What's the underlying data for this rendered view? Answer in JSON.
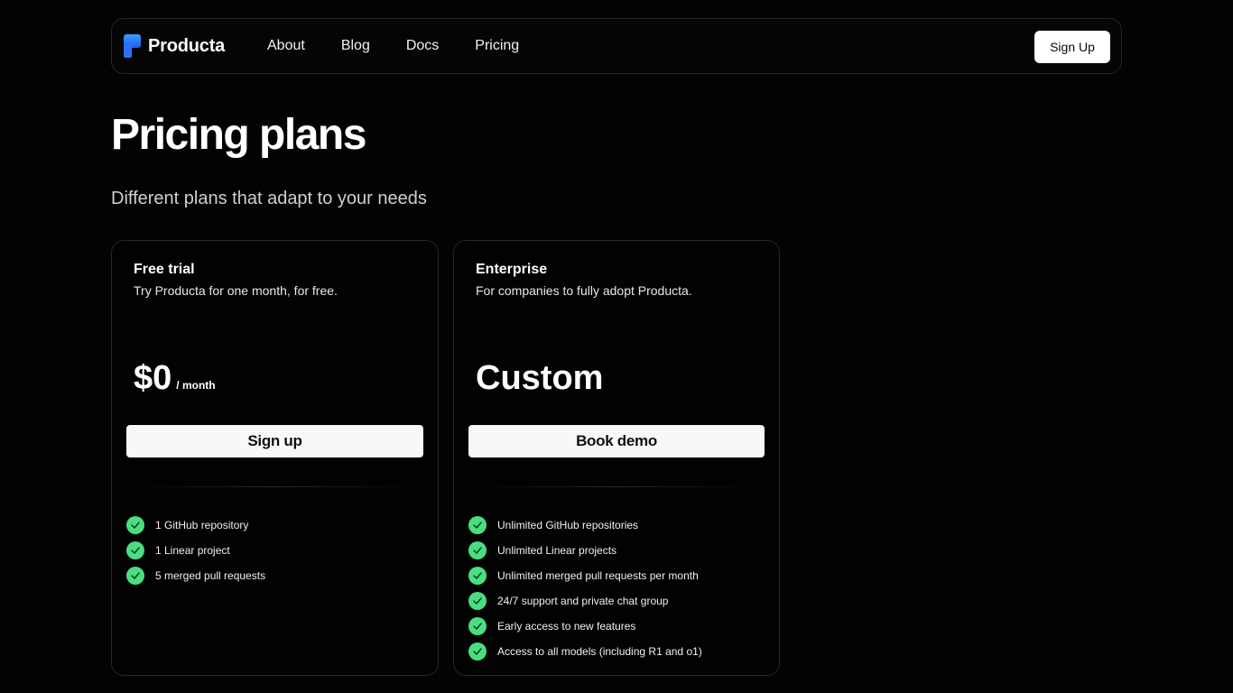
{
  "nav": {
    "brand": "Producta",
    "links": [
      "About",
      "Blog",
      "Docs",
      "Pricing"
    ],
    "signup_label": "Sign Up"
  },
  "page": {
    "title": "Pricing plans",
    "subtitle": "Different plans that adapt to your needs"
  },
  "plans": [
    {
      "name": "Free trial",
      "description": "Try Producta for one month, for free.",
      "price": "$0",
      "price_unit": "/ month",
      "cta": "Sign up",
      "features": [
        "1 GitHub repository",
        "1 Linear project",
        "5 merged pull requests"
      ]
    },
    {
      "name": "Enterprise",
      "description": "For companies to fully adopt Producta.",
      "price": "Custom",
      "price_unit": "",
      "cta": "Book demo",
      "features": [
        "Unlimited GitHub repositories",
        "Unlimited Linear projects",
        "Unlimited merged pull requests per month",
        "24/7 support and private chat group",
        "Early access to new features",
        "Access to all models (including R1 and o1)"
      ]
    }
  ],
  "colors": {
    "background": "#030303",
    "check": "#4ade80",
    "logo_top": "#3aa0ff",
    "logo_bottom": "#1f5bf5"
  },
  "icons": {
    "logo": "producta-logo-icon",
    "check": "check-icon"
  }
}
